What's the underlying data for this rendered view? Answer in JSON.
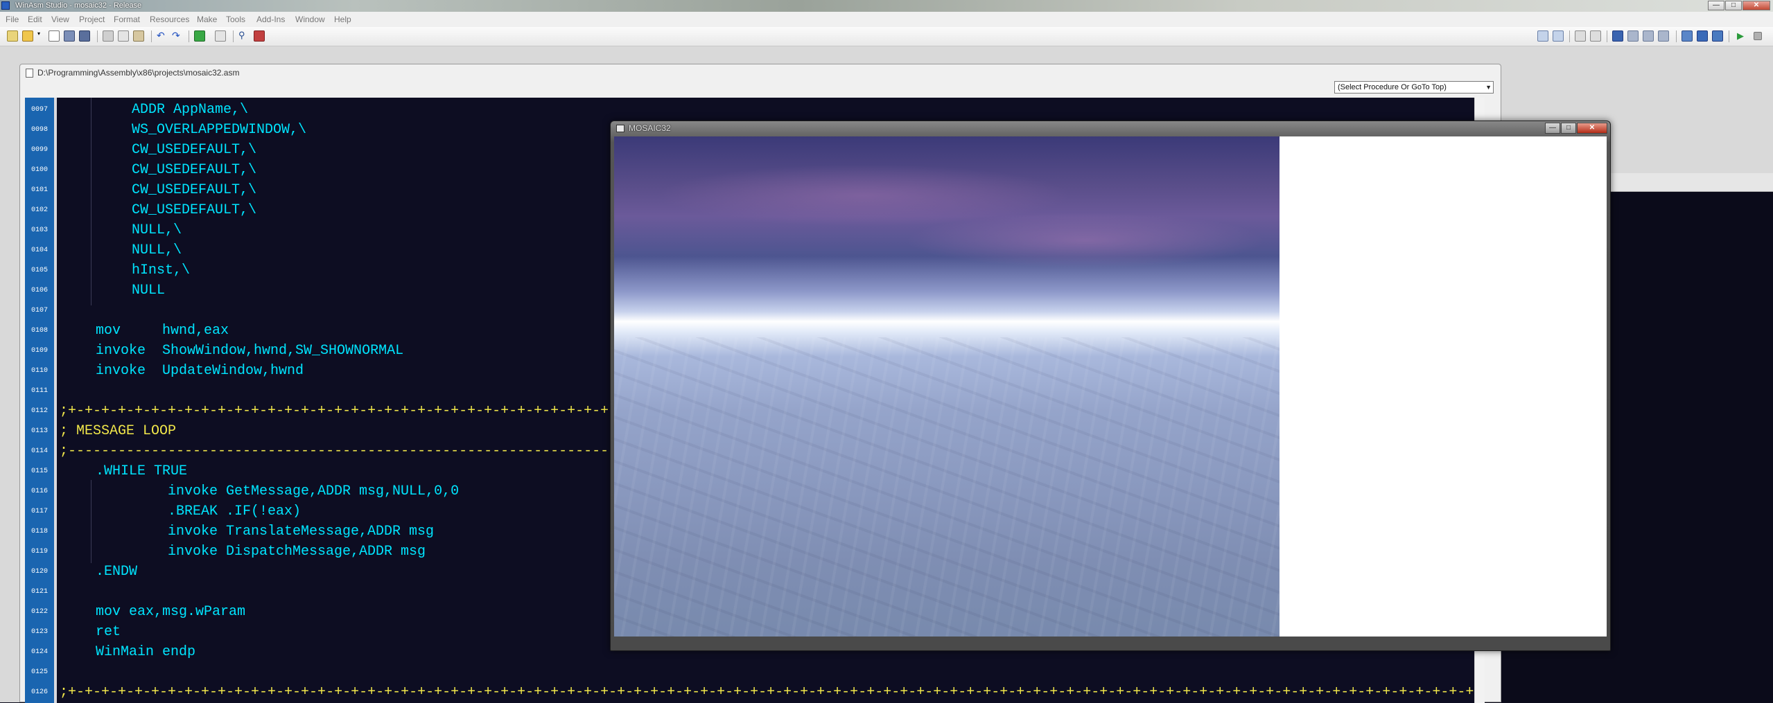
{
  "outer_window": {
    "title": "WinAsm Studio - mosaic32 - Release",
    "buttons": {
      "minimize": "—",
      "maximize": "□",
      "close": "✕"
    }
  },
  "menu": [
    "File",
    "Edit",
    "View",
    "Project",
    "Format",
    "Resources",
    "Make",
    "Tools",
    "Add-Ins",
    "Window",
    "Help"
  ],
  "editor": {
    "file_path": "D:\\Programming\\Assembly\\x86\\projects\\mosaic32.asm",
    "procedure_select": "(Select Procedure Or GoTo Top)",
    "lines": [
      {
        "n": "0097",
        "text": "ADDR AppName,\\",
        "indent": 2,
        "kind": "code"
      },
      {
        "n": "0098",
        "text": "WS_OVERLAPPEDWINDOW,\\",
        "indent": 2,
        "kind": "code"
      },
      {
        "n": "0099",
        "text": "CW_USEDEFAULT,\\",
        "indent": 2,
        "kind": "code"
      },
      {
        "n": "0100",
        "text": "CW_USEDEFAULT,\\",
        "indent": 2,
        "kind": "code"
      },
      {
        "n": "0101",
        "text": "CW_USEDEFAULT,\\",
        "indent": 2,
        "kind": "code"
      },
      {
        "n": "0102",
        "text": "CW_USEDEFAULT,\\",
        "indent": 2,
        "kind": "code"
      },
      {
        "n": "0103",
        "text": "NULL,\\",
        "indent": 2,
        "kind": "code"
      },
      {
        "n": "0104",
        "text": "NULL,\\",
        "indent": 2,
        "kind": "code"
      },
      {
        "n": "0105",
        "text": "hInst,\\",
        "indent": 2,
        "kind": "code"
      },
      {
        "n": "0106",
        "text": "NULL",
        "indent": 2,
        "kind": "code"
      },
      {
        "n": "0107",
        "text": "",
        "indent": 0,
        "kind": "code"
      },
      {
        "n": "0108",
        "text": "mov     hwnd,eax",
        "indent": 1,
        "kind": "code"
      },
      {
        "n": "0109",
        "text": "invoke  ShowWindow,hwnd,SW_SHOWNORMAL",
        "indent": 1,
        "kind": "code"
      },
      {
        "n": "0110",
        "text": "invoke  UpdateWindow,hwnd",
        "indent": 1,
        "kind": "code"
      },
      {
        "n": "0111",
        "text": "",
        "indent": 0,
        "kind": "code"
      },
      {
        "n": "0112",
        "text": ";+-+-+-+-+-+-+-+-+-+-+-+-+-+-+-+-+-+-+-+-+-+-+-+-+-+-+-+-+-+-+-+-+-+-+-+-+-+-+-+-+-+-+-+-+-+-+-+-+-+-",
        "indent": 0,
        "kind": "comment"
      },
      {
        "n": "0113",
        "text": "; MESSAGE LOOP",
        "indent": 0,
        "kind": "comment"
      },
      {
        "n": "0114",
        "text": ";------------------------------------------------------------------------------------------------------------",
        "indent": 0,
        "kind": "comment"
      },
      {
        "n": "0115",
        "text": ".WHILE TRUE",
        "indent": 1,
        "kind": "code"
      },
      {
        "n": "0116",
        "text": "invoke GetMessage,ADDR msg,NULL,0,0",
        "indent": 3,
        "kind": "code"
      },
      {
        "n": "0117",
        "text": ".BREAK .IF(!eax)",
        "indent": 3,
        "kind": "code"
      },
      {
        "n": "0118",
        "text": "invoke TranslateMessage,ADDR msg",
        "indent": 3,
        "kind": "code"
      },
      {
        "n": "0119",
        "text": "invoke DispatchMessage,ADDR msg",
        "indent": 3,
        "kind": "code"
      },
      {
        "n": "0120",
        "text": ".ENDW",
        "indent": 1,
        "kind": "code"
      },
      {
        "n": "0121",
        "text": "",
        "indent": 0,
        "kind": "code"
      },
      {
        "n": "0122",
        "text": "mov eax,msg.wParam",
        "indent": 1,
        "kind": "code"
      },
      {
        "n": "0123",
        "text": "ret",
        "indent": 1,
        "kind": "code"
      },
      {
        "n": "0124",
        "text": "WinMain endp",
        "indent": 1,
        "kind": "code"
      },
      {
        "n": "0125",
        "text": "",
        "indent": 0,
        "kind": "code"
      },
      {
        "n": "0126",
        "text": ";+-+-+-+-+-+-+-+-+-+-+-+-+-+-+-+-+-+-+-+-+-+-+-+-+-+-+-+-+-+-+-+-+-+-+-+-+-+-+-+-+-+-+-+-+-+-+-+-+-+-+-+-+-+-+-+-+-+-+-+-+-+-+-+-+-+-+-+-+-+-+-+-+-+-+-+-+-+-+-+-+-+-+-+-+-+-+-+-+",
        "indent": 0,
        "kind": "comment"
      }
    ]
  },
  "app_window": {
    "title": "MOSAIC32",
    "buttons": {
      "minimize": "—",
      "maximize": "□",
      "close": "✕"
    }
  },
  "colors": {
    "code": "#00e5ff",
    "comment": "#f1e74a",
    "gutter": "#1a65b0",
    "editor_bg": "#0d0d22"
  }
}
